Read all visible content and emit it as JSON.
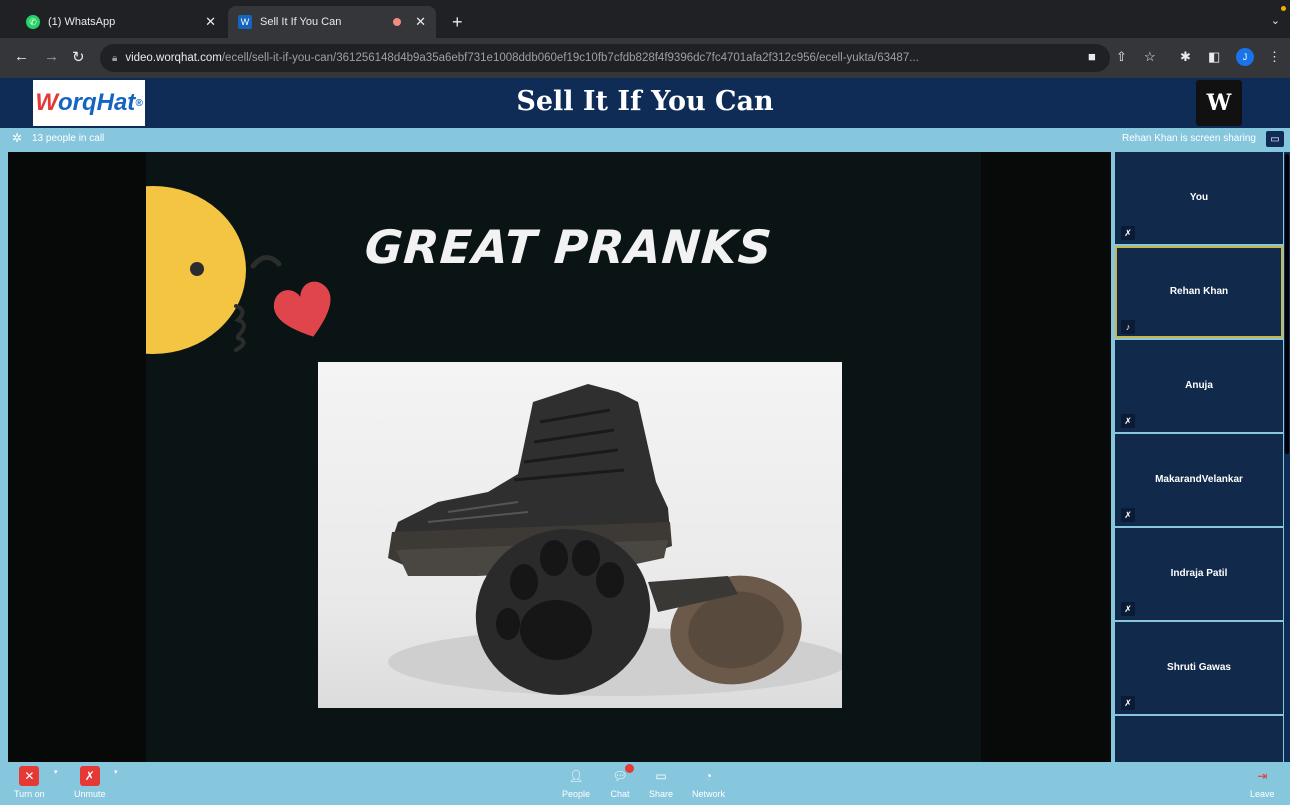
{
  "browser": {
    "tabs": [
      {
        "title": "(1) WhatsApp",
        "active": false
      },
      {
        "title": "Sell It If You Can",
        "active": true
      }
    ],
    "url_host": "video.worqhat.com",
    "url_path": "/ecell/sell-it-if-you-can/361256148d4b9a35a6ebf731e1008ddb060ef19c10fb7cfdb828f4f9396dc7fc4701afa2f312c956/ecell-yukta/63487...",
    "profile_initial": "J"
  },
  "header": {
    "logo_text": "WorqHat",
    "title": "Sell It If You Can"
  },
  "infobar": {
    "people_in_call": "13 people in call",
    "sharing_status": "Rehan Khan is screen sharing"
  },
  "slide": {
    "title": "GREAT PRANKS"
  },
  "participants": [
    {
      "name": "You",
      "active": false
    },
    {
      "name": "Rehan Khan",
      "active": true
    },
    {
      "name": "Anuja",
      "active": false
    },
    {
      "name": "MakarandVelankar",
      "active": false
    },
    {
      "name": "Indraja Patil",
      "active": false
    },
    {
      "name": "Shruti Gawas",
      "active": false
    }
  ],
  "controls": {
    "camera_label": "Turn on",
    "mic_label": "Unmute",
    "people_label": "People",
    "chat_label": "Chat",
    "share_label": "Share",
    "network_label": "Network",
    "leave_label": "Leave"
  },
  "colors": {
    "header_bg": "#0f2c57",
    "accent_bar": "#87c7de",
    "active_border": "#c9b64a",
    "danger": "#e53935"
  }
}
